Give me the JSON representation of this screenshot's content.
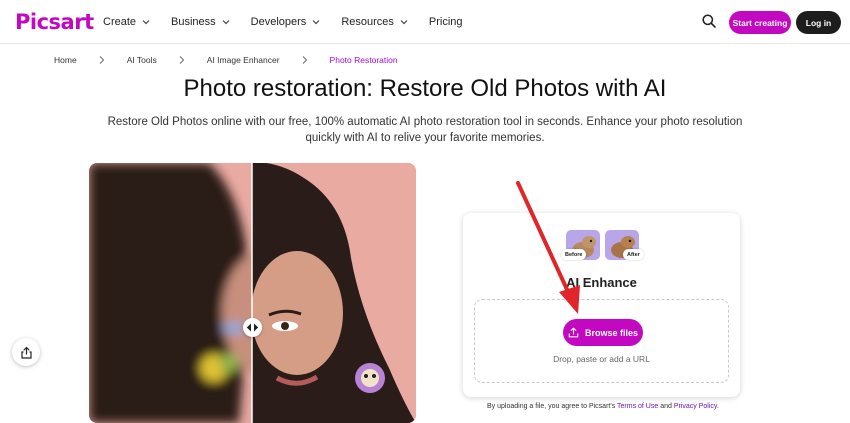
{
  "brand": {
    "logo_text": "Picsart",
    "color": "#c209c1"
  },
  "nav": {
    "items": [
      {
        "label": "Create",
        "has_dropdown": true
      },
      {
        "label": "Business",
        "has_dropdown": true
      },
      {
        "label": "Developers",
        "has_dropdown": true
      },
      {
        "label": "Resources",
        "has_dropdown": true
      },
      {
        "label": "Pricing",
        "has_dropdown": false
      }
    ],
    "search_icon": "search-icon",
    "start_label": "Start creating",
    "login_label": "Log in"
  },
  "breadcrumb": [
    {
      "label": "Home"
    },
    {
      "label": "AI Tools"
    },
    {
      "label": "AI Image Enhancer"
    },
    {
      "label": "Photo Restoration",
      "active": true
    }
  ],
  "hero": {
    "title": "Photo restoration: Restore Old Photos with AI",
    "subtitle": "Restore Old Photos online with our free, 100% automatic AI photo restoration tool in seconds. Enhance your photo resolution quickly with AI to relive your favorite memories."
  },
  "upload_card": {
    "before_label": "Before",
    "after_label": "After",
    "title": "AI Enhance",
    "browse_label": "Browse files",
    "hint": "Drop, paste or add a URL"
  },
  "terms": {
    "prefix": "By uploading a file, you agree to Picsart's ",
    "terms_link": "Terms of Use",
    "and": " and ",
    "privacy_link": "Privacy Policy",
    "suffix": "."
  },
  "colors": {
    "accent": "#c209c1",
    "annotation_arrow": "#e0262a",
    "dark_button": "#1d1d1d"
  }
}
